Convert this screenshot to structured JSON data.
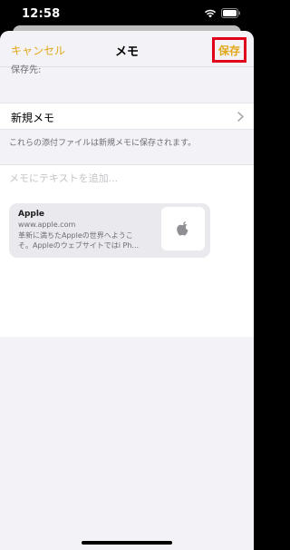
{
  "status_bar": {
    "time": "12:58"
  },
  "navbar": {
    "cancel_label": "キャンセル",
    "title": "メモ",
    "save_label": "保存"
  },
  "destination": {
    "header": "保存先:",
    "value": "新規メモ"
  },
  "footer_note": "これらの添付ファイルは新規メモに保存されます。",
  "note": {
    "placeholder": "メモにテキストを追加..."
  },
  "link_card": {
    "title": "Apple",
    "url": "www.apple.com",
    "description_line1": "革新に満ちたAppleの世界へようこ",
    "description_line2": "そ。Appleのウェブサイトではi Ph...",
    "thumbnail_icon": "apple-logo-icon"
  },
  "colors": {
    "accent": "#e3a81a",
    "highlight_box": "#e0001b"
  }
}
